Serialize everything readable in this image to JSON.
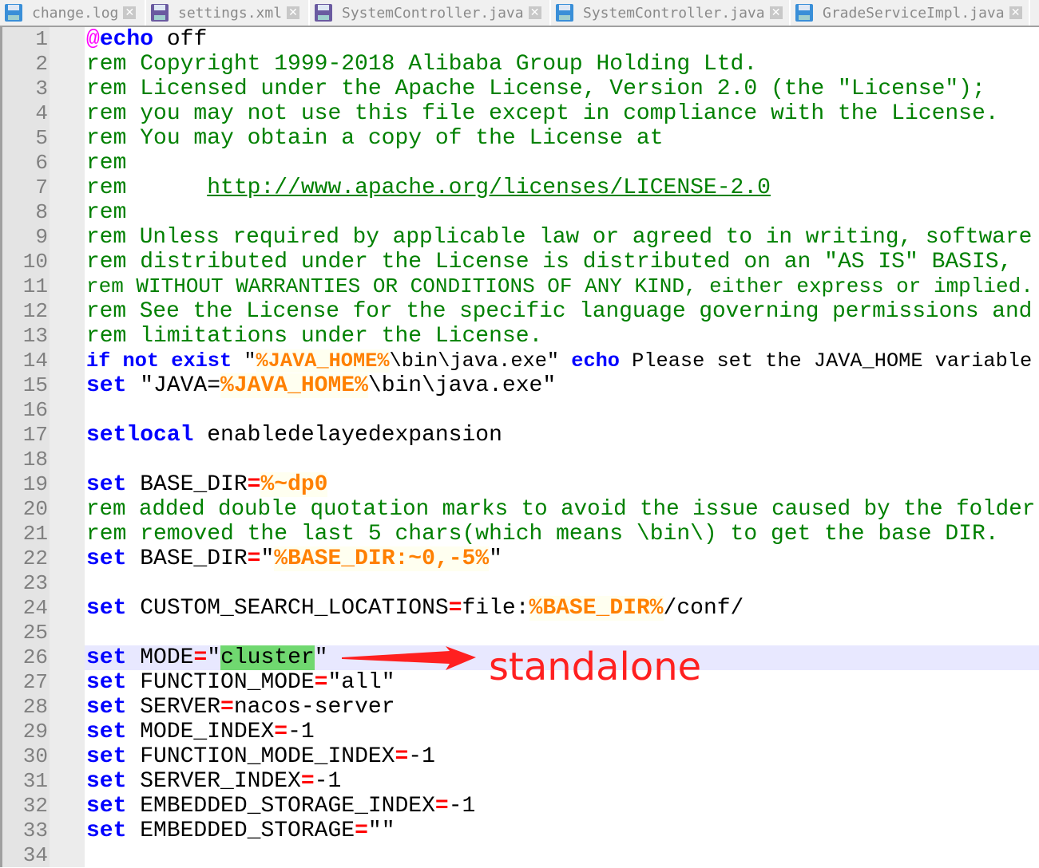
{
  "tabs": [
    {
      "label": "change.log",
      "color": "#3a8fd8"
    },
    {
      "label": "settings.xml",
      "color": "#6a5aa0"
    },
    {
      "label": "SystemController.java",
      "color": "#6a5aa0"
    },
    {
      "label": "SystemController.java",
      "color": "#3a8fd8"
    },
    {
      "label": "GradeServiceImpl.java",
      "color": "#3a8fd8"
    }
  ],
  "tab_close_glyph": "✕",
  "current_line": 26,
  "annotation": "standalone",
  "lines": [
    [
      {
        "c": "at",
        "t": "@"
      },
      {
        "c": "kw",
        "t": "echo"
      },
      {
        "c": "",
        "t": " off"
      }
    ],
    [
      {
        "c": "cm",
        "t": "rem Copyright 1999-2018 Alibaba Group Holding Ltd."
      }
    ],
    [
      {
        "c": "cm",
        "t": "rem Licensed under the Apache License, Version 2.0 (the \"License\");"
      }
    ],
    [
      {
        "c": "cm",
        "t": "rem you may not use this file except in compliance with the License."
      }
    ],
    [
      {
        "c": "cm",
        "t": "rem You may obtain a copy of the License at"
      }
    ],
    [
      {
        "c": "cm",
        "t": "rem"
      }
    ],
    [
      {
        "c": "cm",
        "t": "rem      "
      },
      {
        "c": "url",
        "t": "http://www.apache.org/licenses/LICENSE-2.0"
      }
    ],
    [
      {
        "c": "cm",
        "t": "rem"
      }
    ],
    [
      {
        "c": "cm",
        "t": "rem Unless required by applicable law or agreed to in writing, software"
      }
    ],
    [
      {
        "c": "cm",
        "t": "rem distributed under the License is distributed on an \"AS IS\" BASIS,"
      }
    ],
    [
      {
        "c": "cm",
        "t": "rem WITHOUT WARRANTIES OR CONDITIONS OF ANY KIND, either express or implied."
      }
    ],
    [
      {
        "c": "cm",
        "t": "rem See the License for the specific language governing permissions and"
      }
    ],
    [
      {
        "c": "cm",
        "t": "rem limitations under the License."
      }
    ],
    [
      {
        "c": "kw",
        "t": "if not exist"
      },
      {
        "c": "",
        "t": " \""
      },
      {
        "c": "var",
        "t": "%JAVA_HOME%"
      },
      {
        "c": "",
        "t": "\\bin\\java.exe\" "
      },
      {
        "c": "kw",
        "t": "echo"
      },
      {
        "c": "",
        "t": " Please set the JAVA_HOME variable"
      }
    ],
    [
      {
        "c": "kw",
        "t": "set"
      },
      {
        "c": "",
        "t": " \"JAVA="
      },
      {
        "c": "var",
        "t": "%JAVA_HOME%"
      },
      {
        "c": "",
        "t": "\\bin\\java.exe\""
      }
    ],
    [],
    [
      {
        "c": "kw",
        "t": "setlocal"
      },
      {
        "c": "",
        "t": " enabledelayedexpansion"
      }
    ],
    [],
    [
      {
        "c": "kw",
        "t": "set"
      },
      {
        "c": "",
        "t": " BASE_DIR"
      },
      {
        "c": "op",
        "t": "="
      },
      {
        "c": "var",
        "t": "%~dp0"
      }
    ],
    [
      {
        "c": "cm",
        "t": "rem added double quotation marks to avoid the issue caused by the folder"
      }
    ],
    [
      {
        "c": "cm",
        "t": "rem removed the last 5 chars(which means \\bin\\) to get the base DIR."
      }
    ],
    [
      {
        "c": "kw",
        "t": "set"
      },
      {
        "c": "",
        "t": " BASE_DIR"
      },
      {
        "c": "op",
        "t": "="
      },
      {
        "c": "",
        "t": "\""
      },
      {
        "c": "var",
        "t": "%BASE_DIR:~0,-5%"
      },
      {
        "c": "",
        "t": "\""
      }
    ],
    [],
    [
      {
        "c": "kw",
        "t": "set"
      },
      {
        "c": "",
        "t": " CUSTOM_SEARCH_LOCATIONS"
      },
      {
        "c": "op",
        "t": "="
      },
      {
        "c": "",
        "t": "file:"
      },
      {
        "c": "var",
        "t": "%BASE_DIR%"
      },
      {
        "c": "",
        "t": "/conf/"
      }
    ],
    [],
    [
      {
        "c": "kw",
        "t": "set"
      },
      {
        "c": "",
        "t": " MODE"
      },
      {
        "c": "op",
        "t": "="
      },
      {
        "c": "",
        "t": "\""
      },
      {
        "c": "hl",
        "t": "cluster"
      },
      {
        "c": "",
        "t": "\""
      }
    ],
    [
      {
        "c": "kw",
        "t": "set"
      },
      {
        "c": "",
        "t": " FUNCTION_MODE"
      },
      {
        "c": "op",
        "t": "="
      },
      {
        "c": "",
        "t": "\"all\""
      }
    ],
    [
      {
        "c": "kw",
        "t": "set"
      },
      {
        "c": "",
        "t": " SERVER"
      },
      {
        "c": "op",
        "t": "="
      },
      {
        "c": "",
        "t": "nacos-server"
      }
    ],
    [
      {
        "c": "kw",
        "t": "set"
      },
      {
        "c": "",
        "t": " MODE_INDEX"
      },
      {
        "c": "op",
        "t": "="
      },
      {
        "c": "",
        "t": "-1"
      }
    ],
    [
      {
        "c": "kw",
        "t": "set"
      },
      {
        "c": "",
        "t": " FUNCTION_MODE_INDEX"
      },
      {
        "c": "op",
        "t": "="
      },
      {
        "c": "",
        "t": "-1"
      }
    ],
    [
      {
        "c": "kw",
        "t": "set"
      },
      {
        "c": "",
        "t": " SERVER_INDEX"
      },
      {
        "c": "op",
        "t": "="
      },
      {
        "c": "",
        "t": "-1"
      }
    ],
    [
      {
        "c": "kw",
        "t": "set"
      },
      {
        "c": "",
        "t": " EMBEDDED_STORAGE_INDEX"
      },
      {
        "c": "op",
        "t": "="
      },
      {
        "c": "",
        "t": "-1"
      }
    ],
    [
      {
        "c": "kw",
        "t": "set"
      },
      {
        "c": "",
        "t": " EMBEDDED_STORAGE"
      },
      {
        "c": "op",
        "t": "="
      },
      {
        "c": "",
        "t": "\"\""
      }
    ],
    []
  ]
}
